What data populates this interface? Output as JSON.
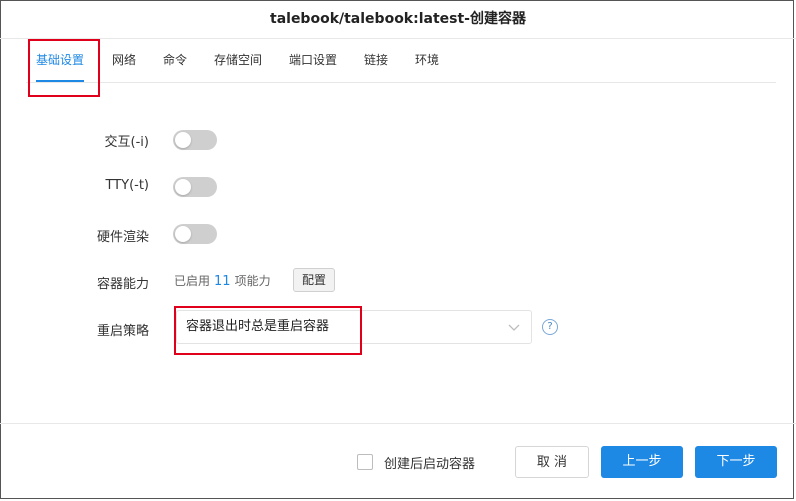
{
  "dialog": {
    "title": "talebook/talebook:latest-创建容器"
  },
  "tabs": [
    {
      "label": "基础设置",
      "active": true
    },
    {
      "label": "网络"
    },
    {
      "label": "命令"
    },
    {
      "label": "存储空间"
    },
    {
      "label": "端口设置"
    },
    {
      "label": "链接"
    },
    {
      "label": "环境"
    }
  ],
  "form": {
    "interactive": {
      "label": "交互(-i)",
      "on": false
    },
    "tty": {
      "label": "TTY(-t)",
      "on": false
    },
    "hw_render": {
      "label": "硬件渲染",
      "on": false
    },
    "capabilities": {
      "label": "容器能力",
      "prefix": "已启用",
      "count": "11",
      "suffix": "项能力",
      "config_button": "配置"
    },
    "restart_policy": {
      "label": "重启策略",
      "value": "容器退出时总是重启容器"
    }
  },
  "footer": {
    "start_after_create_label": "创建后启动容器",
    "start_after_create_checked": false,
    "cancel": "取 消",
    "prev": "上一步",
    "next": "下一步"
  },
  "colors": {
    "accent": "#1e88e5",
    "highlight_box": "#e0001b"
  }
}
